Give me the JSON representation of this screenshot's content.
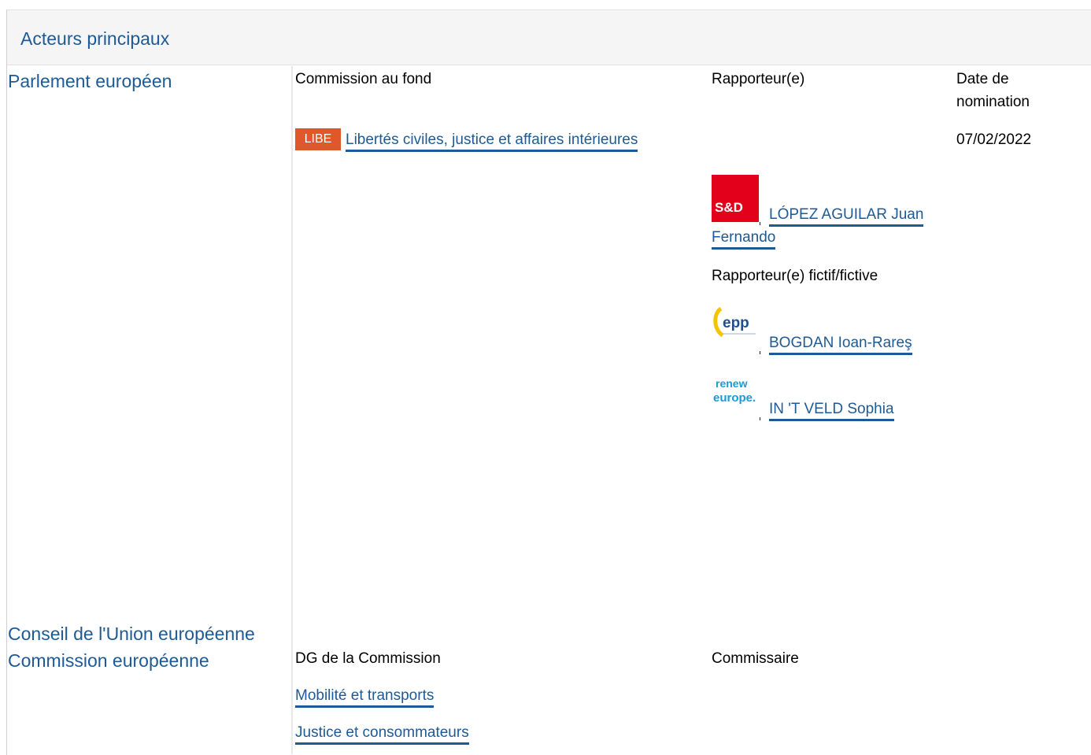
{
  "header": {
    "title": "Acteurs principaux"
  },
  "parliament": {
    "label": "Parlement européen",
    "committee_col": "Commission au fond",
    "rapporteur_col": "Rapporteur(e)",
    "date_col": "Date de nomination",
    "committee_code": "LIBE",
    "committee_name": "Libertés civiles, justice et affaires intérieures",
    "nomination_date": "07/02/2022",
    "rapporteur": {
      "group": "S&D",
      "name_line1": "LÓPEZ AGUILAR Juan",
      "name_line2": "Fernando"
    },
    "shadow_label": "Rapporteur(e) fictif/fictive",
    "shadows": [
      {
        "group_logo_text": "epp",
        "name": "BOGDAN Ioan-Rareş"
      },
      {
        "group_logo_text": "renew europe.",
        "name": "IN 'T VELD Sophia"
      }
    ]
  },
  "council": {
    "label": "Conseil de l'Union européenne"
  },
  "commission": {
    "label": "Commission européenne",
    "dg_col": "DG de la Commission",
    "commissioner_col": "Commissaire",
    "dgs": [
      "Mobilité et transports",
      "Justice et consommateurs"
    ]
  },
  "colors": {
    "link": "#1d5a96",
    "libe": "#e0582a",
    "sd": "#e2001a",
    "epp": "#1d4f91",
    "renew": "#1b9ad6"
  }
}
